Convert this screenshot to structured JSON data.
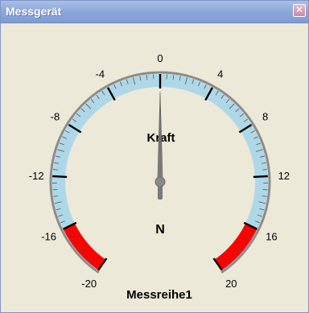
{
  "window": {
    "title": "Messgerät",
    "close_glyph": "✕"
  },
  "gauge": {
    "label": "Kraft",
    "unit": "N",
    "series_name": "Messreihe1",
    "min": -20,
    "max": 20,
    "major_step": 4,
    "minor_step": 0.5,
    "value": 0,
    "tick_labels": [
      "-20",
      "-16",
      "-12",
      "-8",
      "-4",
      "0",
      "4",
      "8",
      "12",
      "16",
      "20"
    ],
    "warning_ranges": [
      [
        -20,
        -16
      ],
      [
        16,
        20
      ]
    ],
    "colors": {
      "scale_band": "#aed8e8",
      "warning_band": "#ff0000",
      "needle": "#7b7b7b",
      "background": "#ece9d8"
    }
  }
}
